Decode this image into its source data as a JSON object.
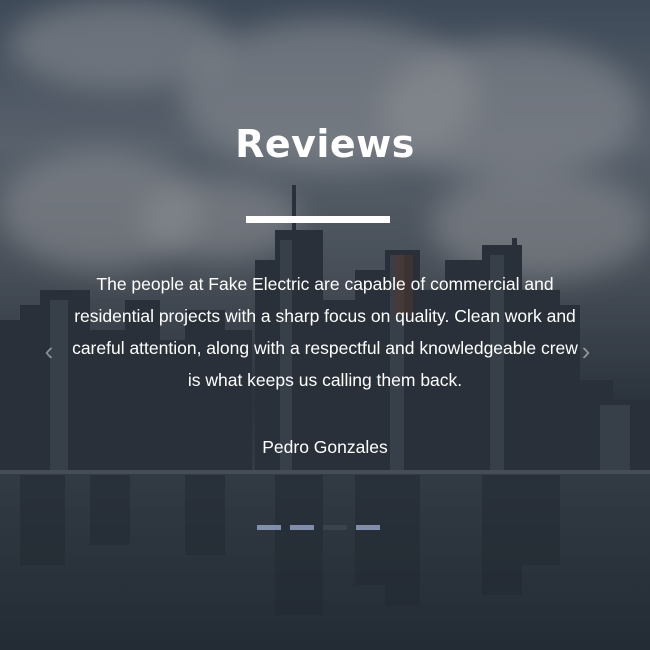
{
  "reviews": {
    "title": "Reviews",
    "quote": "The people at Fake Electric are capable of commercial and residential projects with a sharp focus on quality. Clean work and careful attention, along with a respectful and knowledgeable crew is what keeps us calling them back.",
    "author": "Pedro Gonzales",
    "prev_icon": "chevron-left-icon",
    "next_icon": "chevron-right-icon",
    "indicators": {
      "count": 4,
      "active_index": 2
    }
  },
  "colors": {
    "text": "#ffffff",
    "indicator": "#a0afd2",
    "indicator_active": "#464b55"
  }
}
